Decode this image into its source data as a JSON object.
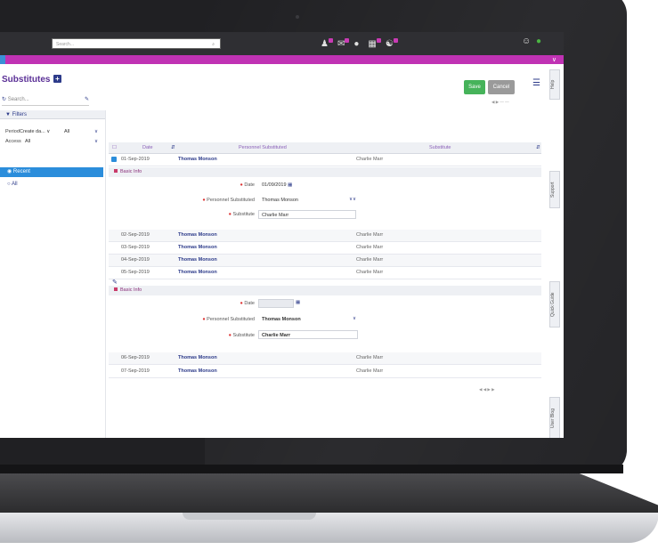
{
  "topbar": {
    "search_placeholder": "Search...",
    "icons": [
      "user-alert-icon",
      "mail-icon",
      "chat-icon",
      "calendar-icon",
      "group-icon",
      "user-icon",
      "status-dot-icon"
    ]
  },
  "page": {
    "title": "Substitutes",
    "add_label": "+"
  },
  "left_panel": {
    "search_placeholder": "Search...",
    "filters_label": "Filters",
    "period_label": "Period",
    "period_value": "Create da...",
    "period_scope": "All",
    "access_label": "Access",
    "access_value": "All",
    "nav_items": [
      {
        "label": "Recent"
      },
      {
        "label": "All"
      }
    ]
  },
  "toolbar": {
    "save_label": "Save",
    "cancel_label": "Cancel"
  },
  "table": {
    "headers": [
      "Date",
      "Personnel Substituted",
      "Substitute"
    ],
    "rows_top": [
      {
        "date": "01-Sep-2019",
        "person": "Thomas Monson",
        "substitute": "Charlie Marr"
      }
    ],
    "rows_mid": [
      {
        "date": "02-Sep-2019",
        "person": "Thomas Monson",
        "substitute": "Charlie Marr"
      },
      {
        "date": "03-Sep-2019",
        "person": "Thomas Monson",
        "substitute": "Charlie Marr"
      },
      {
        "date": "04-Sep-2019",
        "person": "Thomas Monson",
        "substitute": "Charlie Marr"
      },
      {
        "date": "05-Sep-2019",
        "person": "Thomas Monson",
        "substitute": "Charlie Marr"
      }
    ],
    "rows_bottom": [
      {
        "date": "06-Sep-2019",
        "person": "Thomas Monson",
        "substitute": "Charlie Marr"
      },
      {
        "date": "07-Sep-2019",
        "person": "Thomas Monson",
        "substitute": "Charlie Marr"
      }
    ]
  },
  "form1": {
    "section": "Basic Info",
    "date_label": "Date",
    "date_value": "01/09/2019",
    "personnel_label": "Personnel Substituted",
    "personnel_value": "Thomas Monson",
    "substitute_label": "Substitute",
    "substitute_value": "Charlie Marr"
  },
  "form2": {
    "section": "Basic Info",
    "date_label": "Date",
    "personnel_label": "Personnel Substituted",
    "personnel_value": "Thomas Monson",
    "substitute_label": "Substitute",
    "substitute_value": "Charlie Marr"
  },
  "side_tabs": {
    "help": "Help",
    "support": "Support",
    "quick_guide": "Quick Guide",
    "user_blog": "User Blog"
  }
}
